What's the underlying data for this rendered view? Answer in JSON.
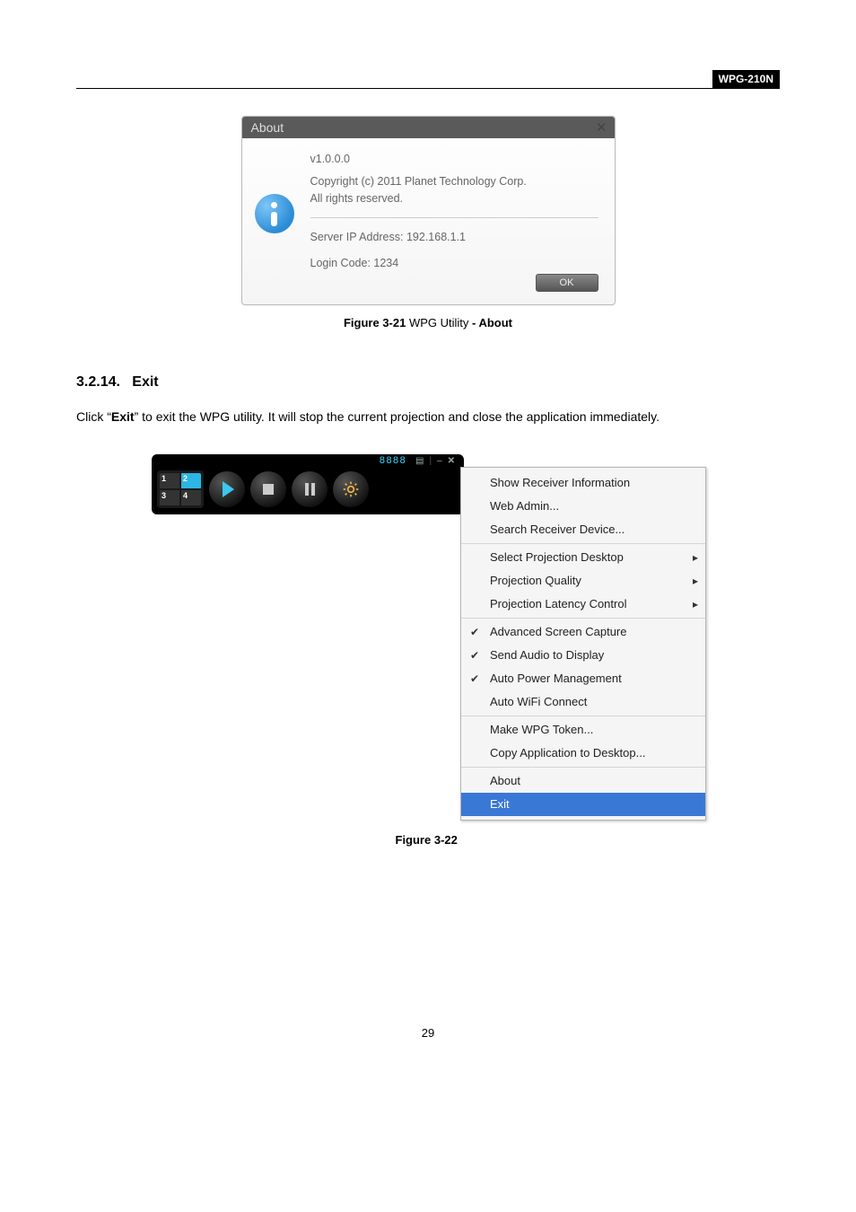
{
  "header": {
    "tag": "WPG-210N"
  },
  "about_dialog": {
    "title": "About",
    "version": "v1.0.0.0",
    "copyright_line1": "Copyright (c) 2011 Planet Technology Corp.",
    "copyright_line2": "All rights reserved.",
    "server_ip_label": "Server IP Address: 192.168.1.1",
    "login_code_label": "Login Code: 1234",
    "ok": "OK"
  },
  "caption1": {
    "fig": "Figure 3-21",
    "mid": " WPG Utility ",
    "suffix": "- About"
  },
  "section": {
    "num": "3.2.14.",
    "title": "Exit"
  },
  "body": {
    "pre": "Click “",
    "bold": "Exit",
    "post": "” to exit the WPG utility. It will stop the current projection and close the application immediately."
  },
  "player": {
    "code": "8888",
    "q1": "1",
    "q2": "2",
    "q3": "3",
    "q4": "4"
  },
  "menu": {
    "g1a": "Show Receiver Information",
    "g1b": "Web Admin...",
    "g1c": "Search Receiver Device...",
    "g2a": "Select Projection Desktop",
    "g2b": "Projection Quality",
    "g2c": "Projection Latency Control",
    "g3a": "Advanced Screen Capture",
    "g3b": "Send Audio to Display",
    "g3c": "Auto Power Management",
    "g3d": "Auto WiFi Connect",
    "g4a": "Make WPG Token...",
    "g4b": "Copy Application to Desktop...",
    "g5a": "About",
    "g5b": "Exit"
  },
  "caption2": {
    "fig": "Figure 3-22"
  },
  "page_number": "29"
}
